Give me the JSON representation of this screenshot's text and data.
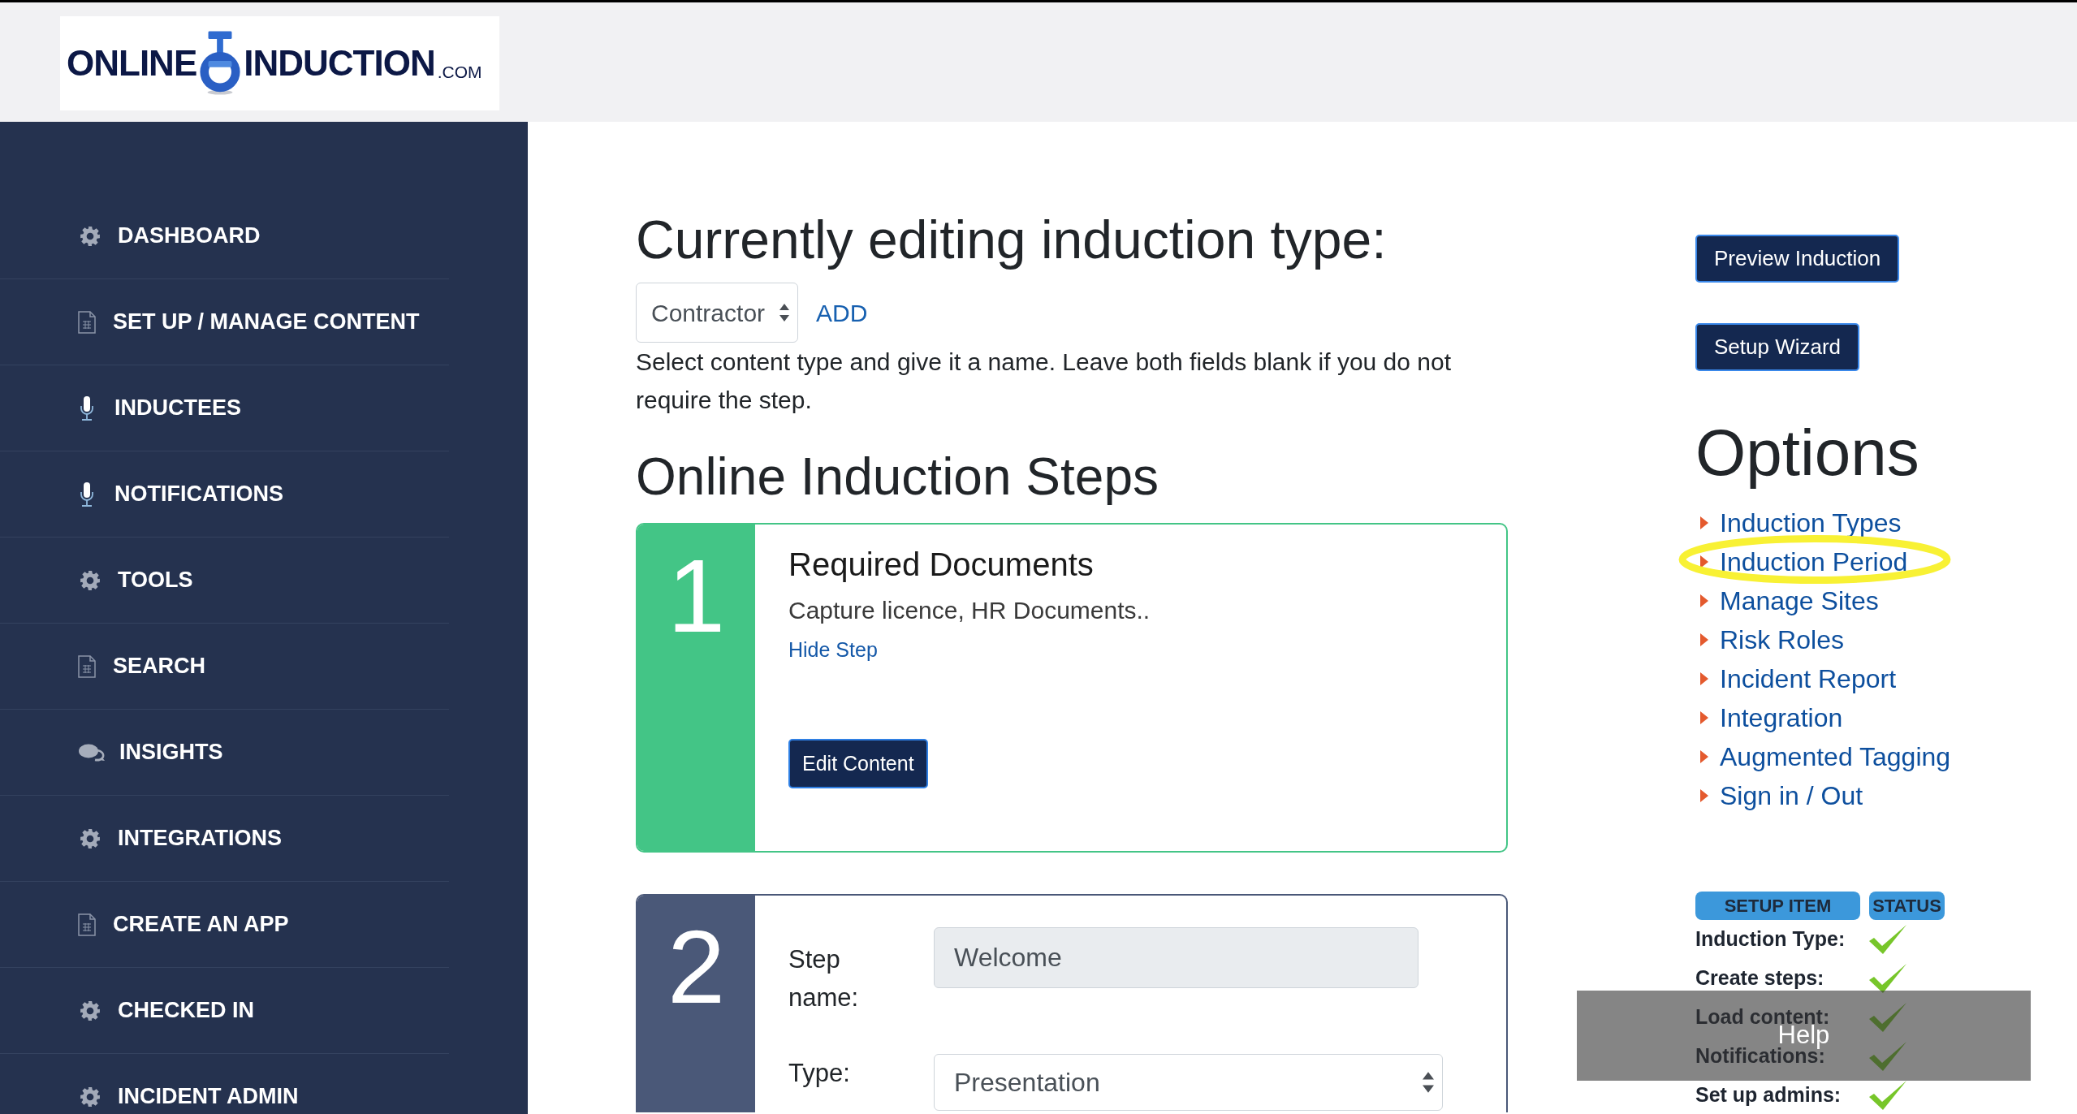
{
  "header": {
    "logo": {
      "name_start": "ONLINE",
      "name_end": "INDUCTION",
      "domain": ".COM"
    }
  },
  "sidebar": {
    "items": [
      {
        "label": "DASHBOARD"
      },
      {
        "label": "SET UP / MANAGE CONTENT"
      },
      {
        "label": "INDUCTEES"
      },
      {
        "label": "NOTIFICATIONS"
      },
      {
        "label": "TOOLS"
      },
      {
        "label": "SEARCH"
      },
      {
        "label": "INSIGHTS"
      },
      {
        "label": "INTEGRATIONS"
      },
      {
        "label": "CREATE AN APP"
      },
      {
        "label": "CHECKED IN"
      },
      {
        "label": "INCIDENT ADMIN"
      }
    ]
  },
  "editor": {
    "title": "Currently editing induction type:",
    "induction_type": {
      "value": "Contractor"
    },
    "add_link": "ADD",
    "instructions": "Select content type and give it a name. Leave both fields blank if you do not require the step.",
    "steps_heading": "Online Induction Steps",
    "steps": [
      {
        "kind": "summary",
        "number": "1",
        "color": "#43c586",
        "title": "Required Documents",
        "description": "Capture licence, HR Documents..",
        "link": "Hide Step",
        "button": "Edit Content"
      },
      {
        "kind": "form",
        "number": "2",
        "color": "#4a5878",
        "fields": [
          {
            "kind": "text",
            "label": "Step name:",
            "value": "Welcome",
            "disabled": true
          },
          {
            "kind": "select",
            "label": "Type:",
            "value": "Presentation",
            "disabled": false
          }
        ]
      }
    ]
  },
  "actions": [
    "Preview Induction",
    "Setup Wizard"
  ],
  "options": {
    "heading": "Options",
    "items": [
      {
        "label": "Induction Types",
        "highlighted": false
      },
      {
        "label": "Induction Period",
        "highlighted": true
      },
      {
        "label": "Manage Sites",
        "highlighted": false
      },
      {
        "label": "Risk Roles",
        "highlighted": false
      },
      {
        "label": "Incident Report",
        "highlighted": false
      },
      {
        "label": "Integration",
        "highlighted": false
      },
      {
        "label": "Augmented Tagging",
        "highlighted": false
      },
      {
        "label": "Sign in / Out",
        "highlighted": false
      }
    ]
  },
  "setup_status": {
    "columns": [
      "SETUP ITEM",
      "STATUS"
    ],
    "rows": [
      {
        "label": "Induction Type:",
        "done": true
      },
      {
        "label": "Create steps:",
        "done": true
      },
      {
        "label": "Load content:",
        "done": true
      },
      {
        "label": "Notifications:",
        "done": true
      },
      {
        "label": "Set up admins:",
        "done": true
      }
    ]
  },
  "help_button": {
    "label": "Help"
  }
}
